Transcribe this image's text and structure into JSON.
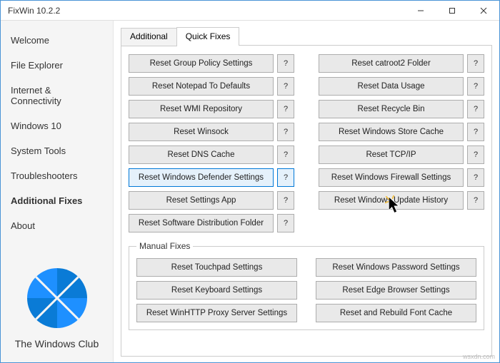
{
  "window": {
    "title": "FixWin 10.2.2"
  },
  "sidebar": {
    "items": [
      {
        "label": "Welcome"
      },
      {
        "label": "File Explorer"
      },
      {
        "label": "Internet & Connectivity"
      },
      {
        "label": "Windows 10"
      },
      {
        "label": "System Tools"
      },
      {
        "label": "Troubleshooters"
      },
      {
        "label": "Additional Fixes"
      },
      {
        "label": "About"
      }
    ],
    "brand": "The Windows Club"
  },
  "tabs": {
    "additional": "Additional",
    "quick_fixes": "Quick Fixes"
  },
  "fixes_left": [
    "Reset Group Policy Settings",
    "Reset Notepad To Defaults",
    "Reset WMI Repository",
    "Reset Winsock",
    "Reset DNS Cache",
    "Reset Windows Defender Settings",
    "Reset Settings App",
    "Reset Software Distribution Folder"
  ],
  "fixes_right": [
    "Reset catroot2 Folder",
    "Reset Data Usage",
    "Reset Recycle Bin",
    "Reset Windows Store Cache",
    "Reset TCP/IP",
    "Reset Windows Firewall Settings",
    "Reset Windows Update History"
  ],
  "help_label": "?",
  "manual": {
    "legend": "Manual Fixes",
    "left": [
      "Reset Touchpad Settings",
      "Reset Keyboard Settings",
      "Reset WinHTTP Proxy Server Settings"
    ],
    "right": [
      "Reset Windows Password Settings",
      "Reset Edge Browser Settings",
      "Reset and Rebuild Font Cache"
    ]
  },
  "watermark": "wsxdn.com"
}
